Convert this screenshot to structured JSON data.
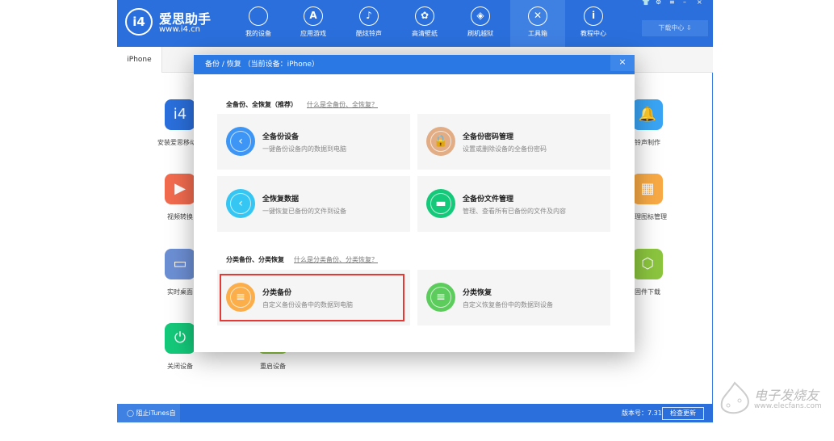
{
  "header": {
    "logo": "i4",
    "brand": "爱思助手",
    "url": "www.i4.cn",
    "nav": [
      {
        "label": "我的设备",
        "icon": "apple-icon",
        "glyph": ""
      },
      {
        "label": "应用游戏",
        "icon": "app-store-icon",
        "glyph": "A"
      },
      {
        "label": "酷炫铃声",
        "icon": "bell-icon",
        "glyph": "♪"
      },
      {
        "label": "高清壁纸",
        "icon": "flower-icon",
        "glyph": "✿"
      },
      {
        "label": "刷机越狱",
        "icon": "box-icon",
        "glyph": "◈"
      },
      {
        "label": "工具箱",
        "icon": "tools-icon",
        "glyph": "✕",
        "active": true
      },
      {
        "label": "教程中心",
        "icon": "info-icon",
        "glyph": "i"
      }
    ],
    "download": "下载中心 ⇩",
    "window_controls": [
      "👕",
      "⚙",
      "≡",
      "–",
      "×"
    ]
  },
  "tab": "iPhone",
  "apps_left": [
    {
      "label": "安装爱思移动端",
      "icon": "i4-icon",
      "color": "#2a6fdc",
      "glyph": "i4"
    },
    {
      "label": "视频转换",
      "icon": "play-icon",
      "color": "#f26b4f",
      "glyph": "▶"
    },
    {
      "label": "实时桌面",
      "icon": "monitor-icon",
      "color": "#6c8fd4",
      "glyph": "▭"
    },
    {
      "label": "关闭设备",
      "icon": "power-icon",
      "color": "#14c97a",
      "glyph": "⏻"
    }
  ],
  "apps_mid": [
    {
      "label": "重启设备"
    }
  ],
  "apps_right": [
    {
      "label": "铃声制作",
      "icon": "bell-plus-icon",
      "color": "#3aa5f5",
      "glyph": "🔔"
    },
    {
      "label": "整理图标管理",
      "icon": "grid-icon",
      "color": "#f9aa45",
      "glyph": "▦"
    },
    {
      "label": "固件下载",
      "icon": "cube-icon",
      "color": "#8cc63f",
      "glyph": "⬡"
    }
  ],
  "footer": {
    "itunes": "◯ 阻止iTunes自动运行",
    "version": "版本号：7.31",
    "check": "检查更新"
  },
  "dialog": {
    "title": "备份 / 恢复  （当前设备：iPhone）",
    "close": "×",
    "section1": {
      "label": "全备份、全恢复（推荐）",
      "link": "什么是全备份、全恢复？"
    },
    "section2": {
      "label": "分类备份、分类恢复",
      "link": "什么是分类备份、分类恢复？"
    },
    "cards": [
      {
        "title": "全备份设备",
        "desc": "一键备份设备内的数据到电脑",
        "color": "#3d96f5",
        "icon": "backup-icon",
        "glyph": "‹"
      },
      {
        "title": "全备份密码管理",
        "desc": "设置或删除设备的全备份密码",
        "color": "#e2ac84",
        "icon": "lock-icon",
        "glyph": "🔒"
      },
      {
        "title": "全恢复数据",
        "desc": "一键恢复已备份的文件到设备",
        "color": "#35c6f4",
        "icon": "restore-icon",
        "glyph": "‹"
      },
      {
        "title": "全备份文件管理",
        "desc": "管理、查看所有已备份的文件及内容",
        "color": "#14c97a",
        "icon": "folder-icon",
        "glyph": "▬"
      },
      {
        "title": "分类备份",
        "desc": "自定义备份设备中的数据到电脑",
        "color": "#fbae4a",
        "icon": "category-backup-icon",
        "glyph": "≡",
        "highlighted": true
      },
      {
        "title": "分类恢复",
        "desc": "自定义恢复备份中的数据到设备",
        "color": "#5ccc5c",
        "icon": "category-restore-icon",
        "glyph": "≡"
      }
    ]
  },
  "watermark": {
    "name": "电子发烧友",
    "url": "www.elecfans.com"
  }
}
